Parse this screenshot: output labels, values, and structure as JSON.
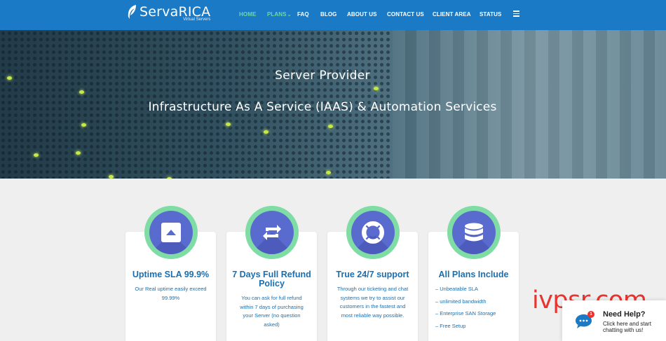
{
  "header": {
    "logo_title": "ServaRICA",
    "logo_subtitle": "Virtual Servers",
    "menu": [
      "HOME",
      "PLANS",
      "FAQ",
      "BLOG",
      "ABOUT US",
      "CONTACT US",
      "CLIENT AREA",
      "STATUS"
    ],
    "active_item": "HOME"
  },
  "hero": {
    "title": "Server Provider",
    "subtitle": "Infrastructure As A Service (IAAS) & Automation Services"
  },
  "cards": [
    {
      "icon": "arrow-up-square-icon",
      "title": "Uptime SLA 99.9%",
      "text": [
        "Our Real uptime easily exceed",
        "99.99%"
      ]
    },
    {
      "icon": "refresh-arrows-icon",
      "title_lines": [
        "7 Days Full Refund",
        "Policy"
      ],
      "text": [
        "You can ask for full refund",
        "within 7 days of purchasing",
        "your Server (no question",
        "asked)"
      ]
    },
    {
      "icon": "lifebuoy-icon",
      "title": "True 24/7 support",
      "text": [
        "Through our ticketing and chat",
        "systems we try to assist our",
        "customers in the fastest and",
        "most reliable way possible."
      ]
    },
    {
      "icon": "database-icon",
      "title": "All Plans Include",
      "items": [
        "– Unbeatable SLA",
        "– unlimited bandwidth",
        "– Enterprise SAN Storage",
        "– Free Setup"
      ]
    }
  ],
  "watermark": "ivpsr.com",
  "chat": {
    "badge": "1",
    "title": "Need Help?",
    "line1": "Click here and start",
    "line2": "chatting with us!"
  },
  "colors": {
    "nav": "#1a7ac6",
    "active": "#6fd7a7",
    "card_text": "#1c6fae",
    "ring": "#7fdca4",
    "disc": "#5a6bd0",
    "watermark": "#e8332e"
  }
}
